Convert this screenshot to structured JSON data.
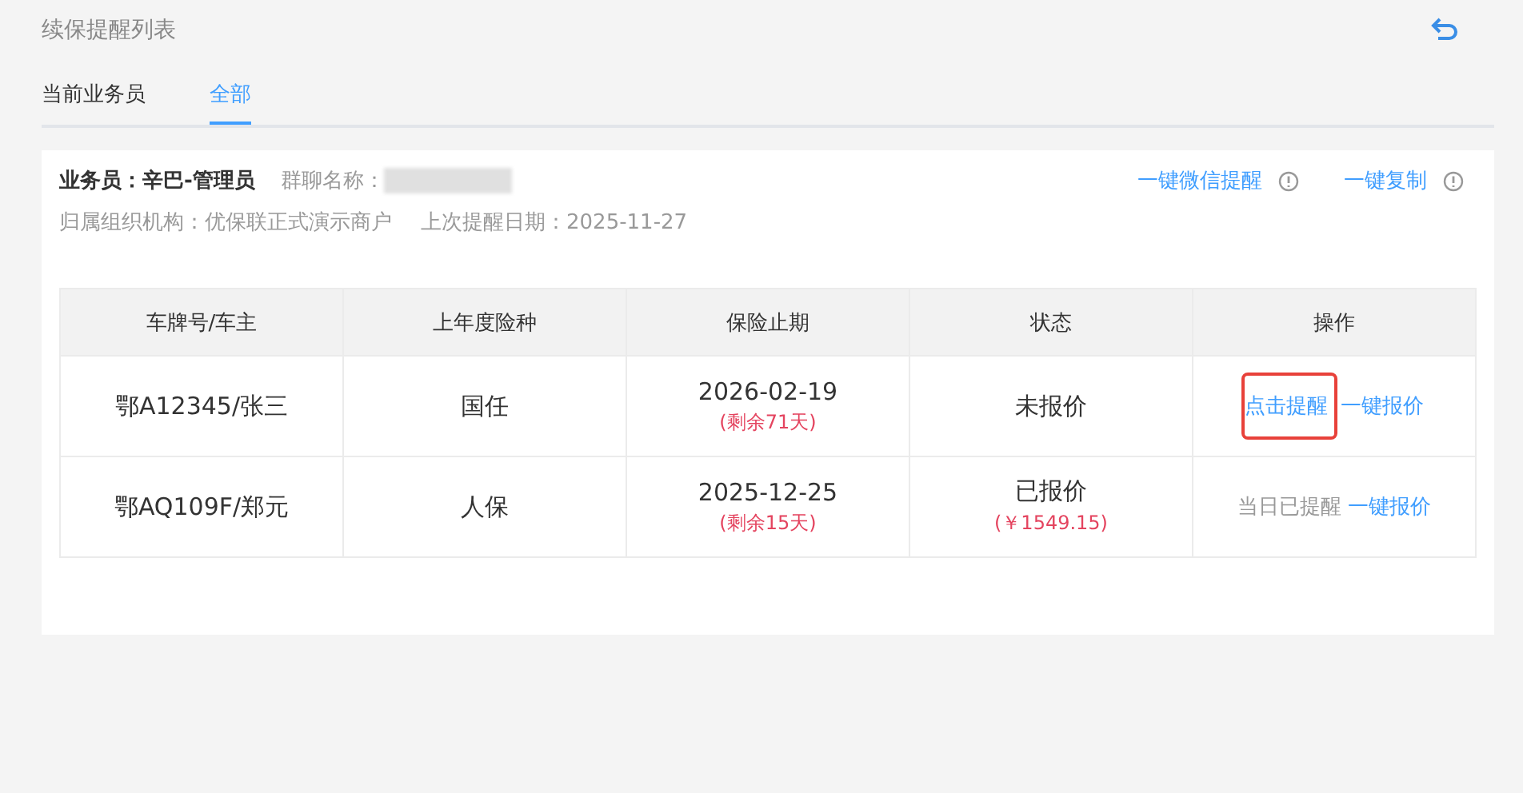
{
  "page_title": "续保提醒列表",
  "tabs": [
    {
      "label": "当前业务员",
      "selected": false
    },
    {
      "label": "全部",
      "selected": true
    }
  ],
  "info": {
    "salesman": "业务员：辛巴-管理员",
    "group_label": "群聊名称：",
    "group_redacted": true,
    "org": "归属组织机构：优保联正式演示商户",
    "last_remind": "上次提醒日期：2025-11-27"
  },
  "actions": [
    "一键微信提醒",
    "一键复制"
  ],
  "table": {
    "columns": [
      "车牌号/车主",
      "上年度险种",
      "保险止期",
      "状态",
      "操作"
    ],
    "rows": [
      {
        "plate": "鄂A12345/张三",
        "insurer": "国任",
        "expiry": "2026-02-19",
        "remaining": "(剩余71天)",
        "status": "未报价",
        "price": null,
        "ops": [
          {
            "label": "点击提醒",
            "kind": "link",
            "highlighted": true
          },
          {
            "label": "一键报价",
            "kind": "link",
            "highlighted": false
          }
        ]
      },
      {
        "plate": "鄂AQ109F/郑元",
        "insurer": "人保",
        "expiry": "2025-12-25",
        "remaining": "(剩余15天)",
        "status": "已报价",
        "price": "(￥1549.15)",
        "ops": [
          {
            "label": "当日已提醒",
            "kind": "done",
            "highlighted": false
          },
          {
            "label": "一键报价",
            "kind": "link",
            "highlighted": false
          }
        ]
      }
    ]
  }
}
